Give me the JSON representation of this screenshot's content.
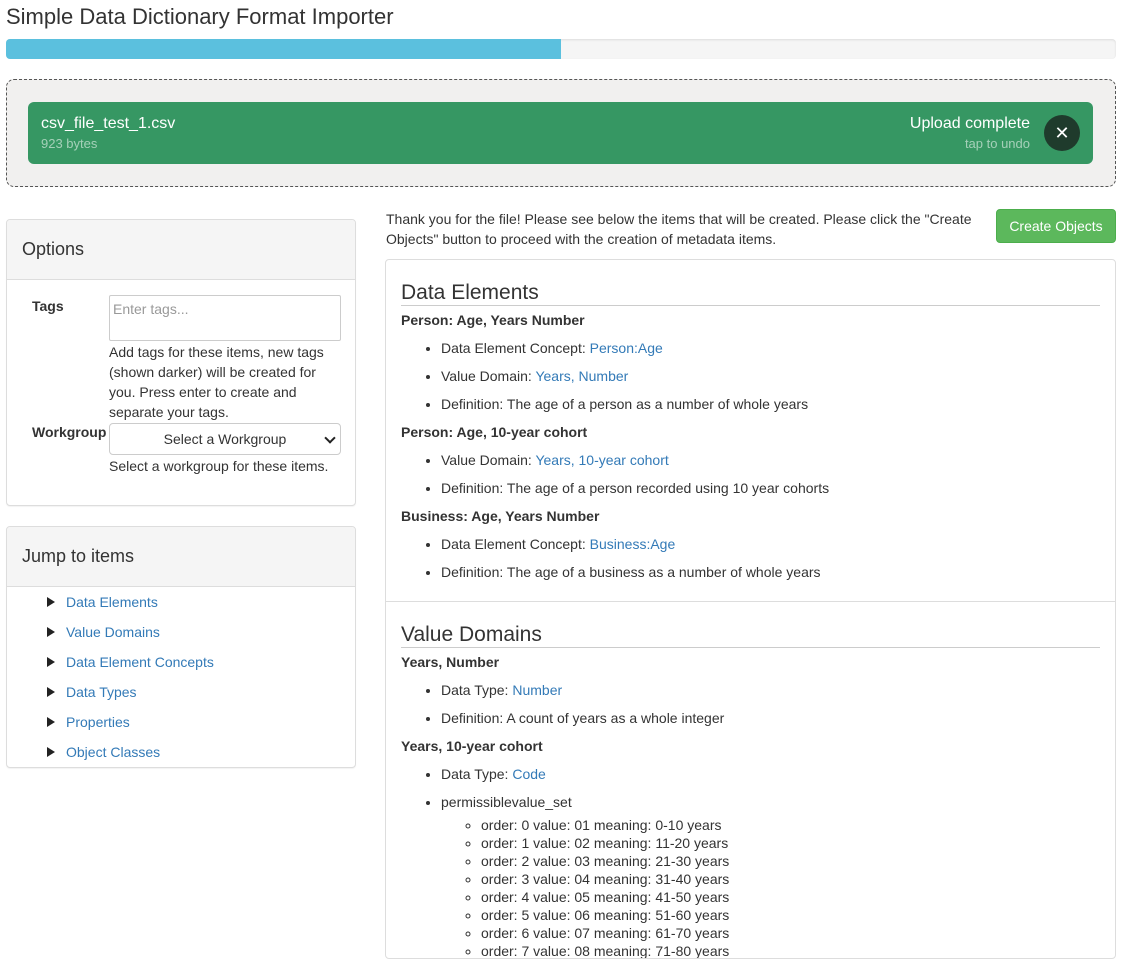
{
  "page": {
    "title": "Simple Data Dictionary Format Importer"
  },
  "progress": {
    "percent": 50
  },
  "upload": {
    "file_name": "csv_file_test_1.csv",
    "file_size": "923 bytes",
    "status": "Upload complete",
    "undo_hint": "tap to undo",
    "close_icon": "close-icon"
  },
  "options": {
    "title": "Options",
    "tags_label": "Tags",
    "tags_placeholder": "Enter tags...",
    "tags_help": "Add tags for these items, new tags (shown darker) will be created for you. Press enter to create and separate your tags.",
    "workgroup_label": "Workgroup",
    "workgroup_selected": "Select a Workgroup",
    "workgroup_help": "Select a workgroup for these items."
  },
  "jump": {
    "title": "Jump to items",
    "items": [
      "Data Elements",
      "Value Domains",
      "Data Element Concepts",
      "Data Types",
      "Properties",
      "Object Classes"
    ]
  },
  "main": {
    "intro": "Thank you for the file! Please see below the items that will be created. Please click the \"Create Objects\" button to proceed with the creation of metadata items.",
    "create_button": "Create Objects",
    "data_elements": {
      "title": "Data Elements",
      "items": [
        {
          "name": "Person: Age, Years Number",
          "dec_label": "Data Element Concept: ",
          "dec_value": "Person:Age",
          "vd_label": "Value Domain: ",
          "vd_value": "Years, Number",
          "def": "Definition: The age of a person as a number of whole years"
        },
        {
          "name": "Person: Age, 10-year cohort",
          "vd_label": "Value Domain: ",
          "vd_value": "Years, 10-year cohort",
          "def": "Definition: The age of a person recorded using 10 year cohorts"
        },
        {
          "name": "Business: Age, Years Number",
          "dec_label": "Data Element Concept: ",
          "dec_value": "Business:Age",
          "def": "Definition: The age of a business as a number of whole years"
        }
      ]
    },
    "value_domains": {
      "title": "Value Domains",
      "items": [
        {
          "name": "Years, Number",
          "dt_label": "Data Type: ",
          "dt_value": "Number",
          "def": "Definition: A count of years as a whole integer"
        },
        {
          "name": "Years, 10-year cohort",
          "dt_label": "Data Type: ",
          "dt_value": "Code",
          "pv_label": "permissiblevalue_set",
          "values": [
            "order: 0 value: 01 meaning: 0-10 years",
            "order: 1 value: 02 meaning: 11-20 years",
            "order: 2 value: 03 meaning: 21-30 years",
            "order: 3 value: 04 meaning: 31-40 years",
            "order: 4 value: 05 meaning: 41-50 years",
            "order: 5 value: 06 meaning: 51-60 years",
            "order: 6 value: 07 meaning: 61-70 years",
            "order: 7 value: 08 meaning: 71-80 years"
          ]
        }
      ]
    }
  }
}
